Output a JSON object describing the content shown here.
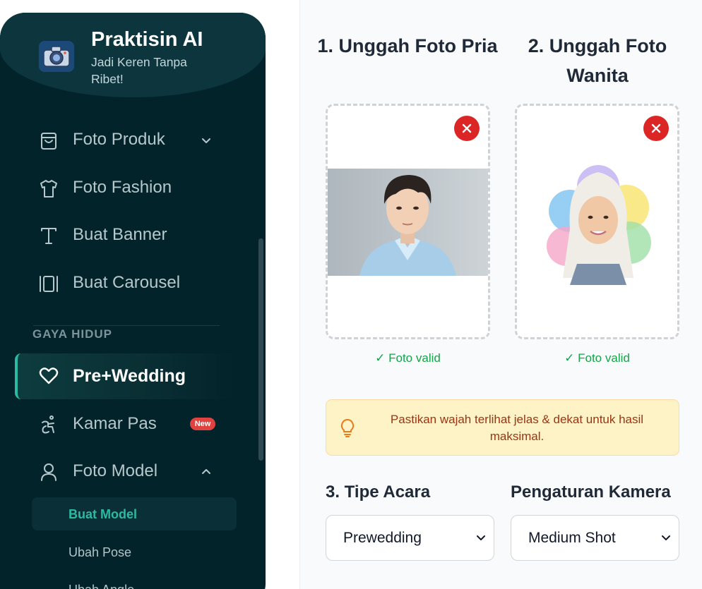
{
  "brand": {
    "title": "Praktisin AI",
    "subtitle": "Jadi Keren Tanpa Ribet!"
  },
  "sidebar": {
    "items": [
      {
        "label": "Foto Produk",
        "icon": "shopping-bag-icon",
        "has_chevron": "down"
      },
      {
        "label": "Foto Fashion",
        "icon": "shirt-icon"
      },
      {
        "label": "Buat Banner",
        "icon": "text-t-icon"
      },
      {
        "label": "Buat Carousel",
        "icon": "carousel-icon"
      }
    ],
    "section_title": "GAYA HIDUP",
    "active_item": {
      "label": "Pre+Wedding",
      "icon": "heart-icon"
    },
    "lifestyle_items": [
      {
        "label": "Kamar Pas",
        "icon": "accessibility-icon",
        "badge": "New"
      },
      {
        "label": "Foto Model",
        "icon": "user-icon",
        "has_chevron": "up"
      }
    ],
    "sub_items": [
      {
        "label": "Buat Model",
        "active": true
      },
      {
        "label": "Ubah Pose"
      },
      {
        "label": "Ubah Angle"
      }
    ]
  },
  "uploads": {
    "male": {
      "title": "1. Unggah Foto Pria",
      "status": "✓ Foto valid"
    },
    "female": {
      "title": "2. Unggah Foto Wanita",
      "status": "✓ Foto valid"
    }
  },
  "tip": {
    "text": "Pastikan wajah terlihat jelas & dekat untuk hasil maksimal."
  },
  "event_type": {
    "label": "3. Tipe Acara",
    "selected": "Prewedding"
  },
  "camera": {
    "label": "Pengaturan Kamera",
    "selected": "Medium Shot"
  },
  "colors": {
    "sidebar_bg": "#03232b",
    "accent": "#2bbaa3",
    "danger": "#dc2626",
    "success": "#16a34a",
    "new_badge": "#e0433f"
  }
}
